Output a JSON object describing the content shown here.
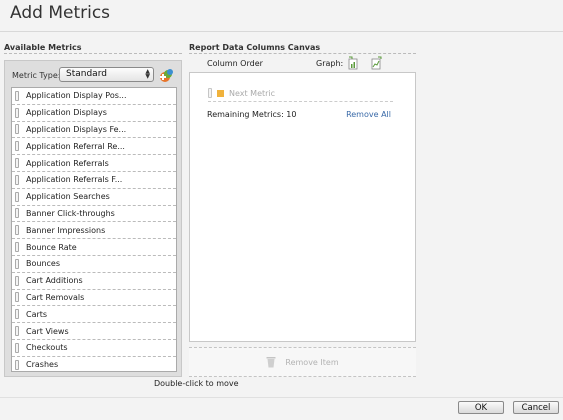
{
  "dialog": {
    "title": "Add Metrics"
  },
  "available": {
    "header": "Available Metrics",
    "metric_type_label": "Metric Type:",
    "metric_type_value": "Standard",
    "metrics": [
      "Application Display Pos...",
      "Application Displays",
      "Application Displays Fe...",
      "Application Referral Re...",
      "Application Referrals",
      "Application Referrals F...",
      "Application Searches",
      "Banner Click-throughs",
      "Banner Impressions",
      "Bounce Rate",
      "Bounces",
      "Cart Additions",
      "Cart Removals",
      "Carts",
      "Cart Views",
      "Checkouts",
      "Crashes"
    ],
    "hint": "Double-click to move"
  },
  "canvas": {
    "header": "Report Data Columns Canvas",
    "column_order_label": "Column Order",
    "graph_label": "Graph:",
    "next_metric": "Next Metric",
    "remaining": "Remaining Metrics: 10",
    "remove_all": "Remove All",
    "remove_item": "Remove Item"
  },
  "buttons": {
    "ok": "OK",
    "cancel": "Cancel"
  },
  "icons": {
    "add": "add-metric-icon",
    "graph_left": "graph-bar-icon",
    "graph_right": "graph-line-icon",
    "trash": "trash-icon"
  },
  "colors": {
    "accent_link": "#3a6aa8",
    "next_metric_marker": "#f0b23c",
    "background": "#f3f3f3"
  }
}
